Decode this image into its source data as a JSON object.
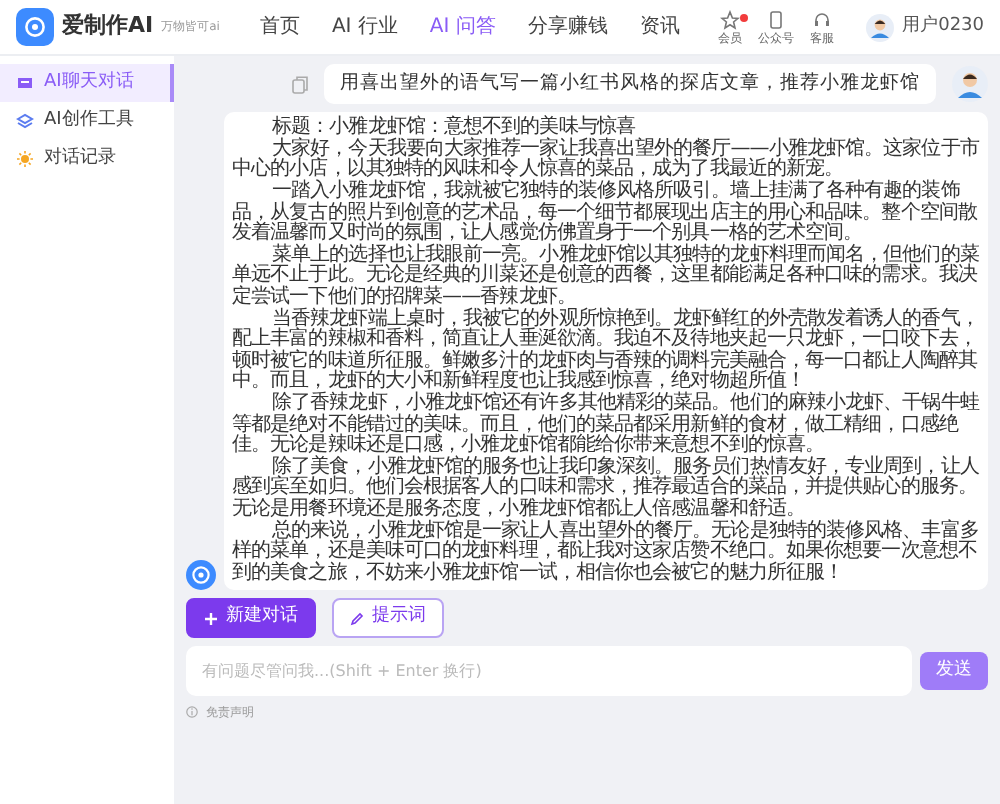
{
  "header": {
    "logo": "爱制作AI",
    "slogan": "万物皆可ai",
    "nav": [
      {
        "label": "首页",
        "selected": false
      },
      {
        "label": "AI 行业",
        "selected": false
      },
      {
        "label": "AI 问答",
        "selected": true
      },
      {
        "label": "分享赚钱",
        "selected": false
      },
      {
        "label": "资讯",
        "selected": false
      }
    ],
    "tools": [
      {
        "label": "会员",
        "dot": true
      },
      {
        "label": "公众号",
        "dot": false
      },
      {
        "label": "客服",
        "dot": false
      }
    ],
    "user": "用户0230"
  },
  "sidebar": {
    "items": [
      {
        "label": "AI聊天对话",
        "selected": true
      },
      {
        "label": "AI创作工具",
        "selected": false
      },
      {
        "label": "对话记录",
        "selected": false
      }
    ]
  },
  "chat": {
    "messages": [
      {
        "kind": "prompt",
        "text": "用喜出望外的语气写一篇小红书风格的探店文章，推荐小雅龙虾馆"
      },
      {
        "kind": "reply",
        "title": "标题：小雅龙虾馆：意想不到的美味与惊喜",
        "paragraphs": [
          "大家好，今天我要向大家推荐一家让我喜出望外的餐厅——小雅龙虾馆。这家位于市中心的小店，以其独特的风味和令人惊喜的菜品，成为了我最近的新宠。",
          "一踏入小雅龙虾馆，我就被它独特的装修风格所吸引。墙上挂满了各种有趣的装饰品，从复古的照片到创意的艺术品，每一个细节都展现出店主的用心和品味。整个空间散发着温馨而又时尚的氛围，让人感觉仿佛置身于一个别具一格的艺术空间。",
          "菜单上的选择也让我眼前一亮。小雅龙虾馆以其独特的龙虾料理而闻名，但他们的菜单远不止于此。无论是经典的川菜还是创意的西餐，这里都能满足各种口味的需求。我决定尝试一下他们的招牌菜——香辣龙虾。",
          "当香辣龙虾端上桌时，我被它的外观所惊艳到。龙虾鲜红的外壳散发着诱人的香气，配上丰富的辣椒和香料，简直让人垂涎欲滴。我迫不及待地夹起一只龙虾，一口咬下去，顿时被它的味道所征服。鲜嫩多汁的龙虾肉与香辣的调料完美融合，每一口都让人陶醉其中。而且，龙虾的大小和新鲜程度也让我感到惊喜，绝对物超所值！",
          "除了香辣龙虾，小雅龙虾馆还有许多其他精彩的菜品。他们的麻辣小龙虾、干锅牛蛙等都是绝对不能错过的美味。而且，他们的菜品都采用新鲜的食材，做工精细，口感绝佳。无论是辣味还是口感，小雅龙虾馆都能给你带来意想不到的惊喜。",
          "除了美食，小雅龙虾馆的服务也让我印象深刻。服务员们热情友好，专业周到，让人感到宾至如归。他们会根据客人的口味和需求，推荐最适合的菜品，并提供贴心的服务。无论是用餐环境还是服务态度，小雅龙虾馆都让人倍感温馨和舒适。",
          "总的来说，小雅龙虾馆是一家让人喜出望外的餐厅。无论是独特的装修风格、丰富多样的菜单，还是美味可口的龙虾料理，都让我对这家店赞不绝口。如果你想要一次意想不到的美食之旅，不妨来小雅龙虾馆一试，相信你也会被它的魅力所征服！"
        ]
      }
    ]
  },
  "actions": [
    {
      "label": "新建对话",
      "kind": "primary"
    },
    {
      "label": "提示词",
      "kind": "outline"
    }
  ],
  "composer": {
    "placeholder": "有问题尽管问我...(Shift + Enter 换行)",
    "send": "发送"
  },
  "footer": "免责声明"
}
